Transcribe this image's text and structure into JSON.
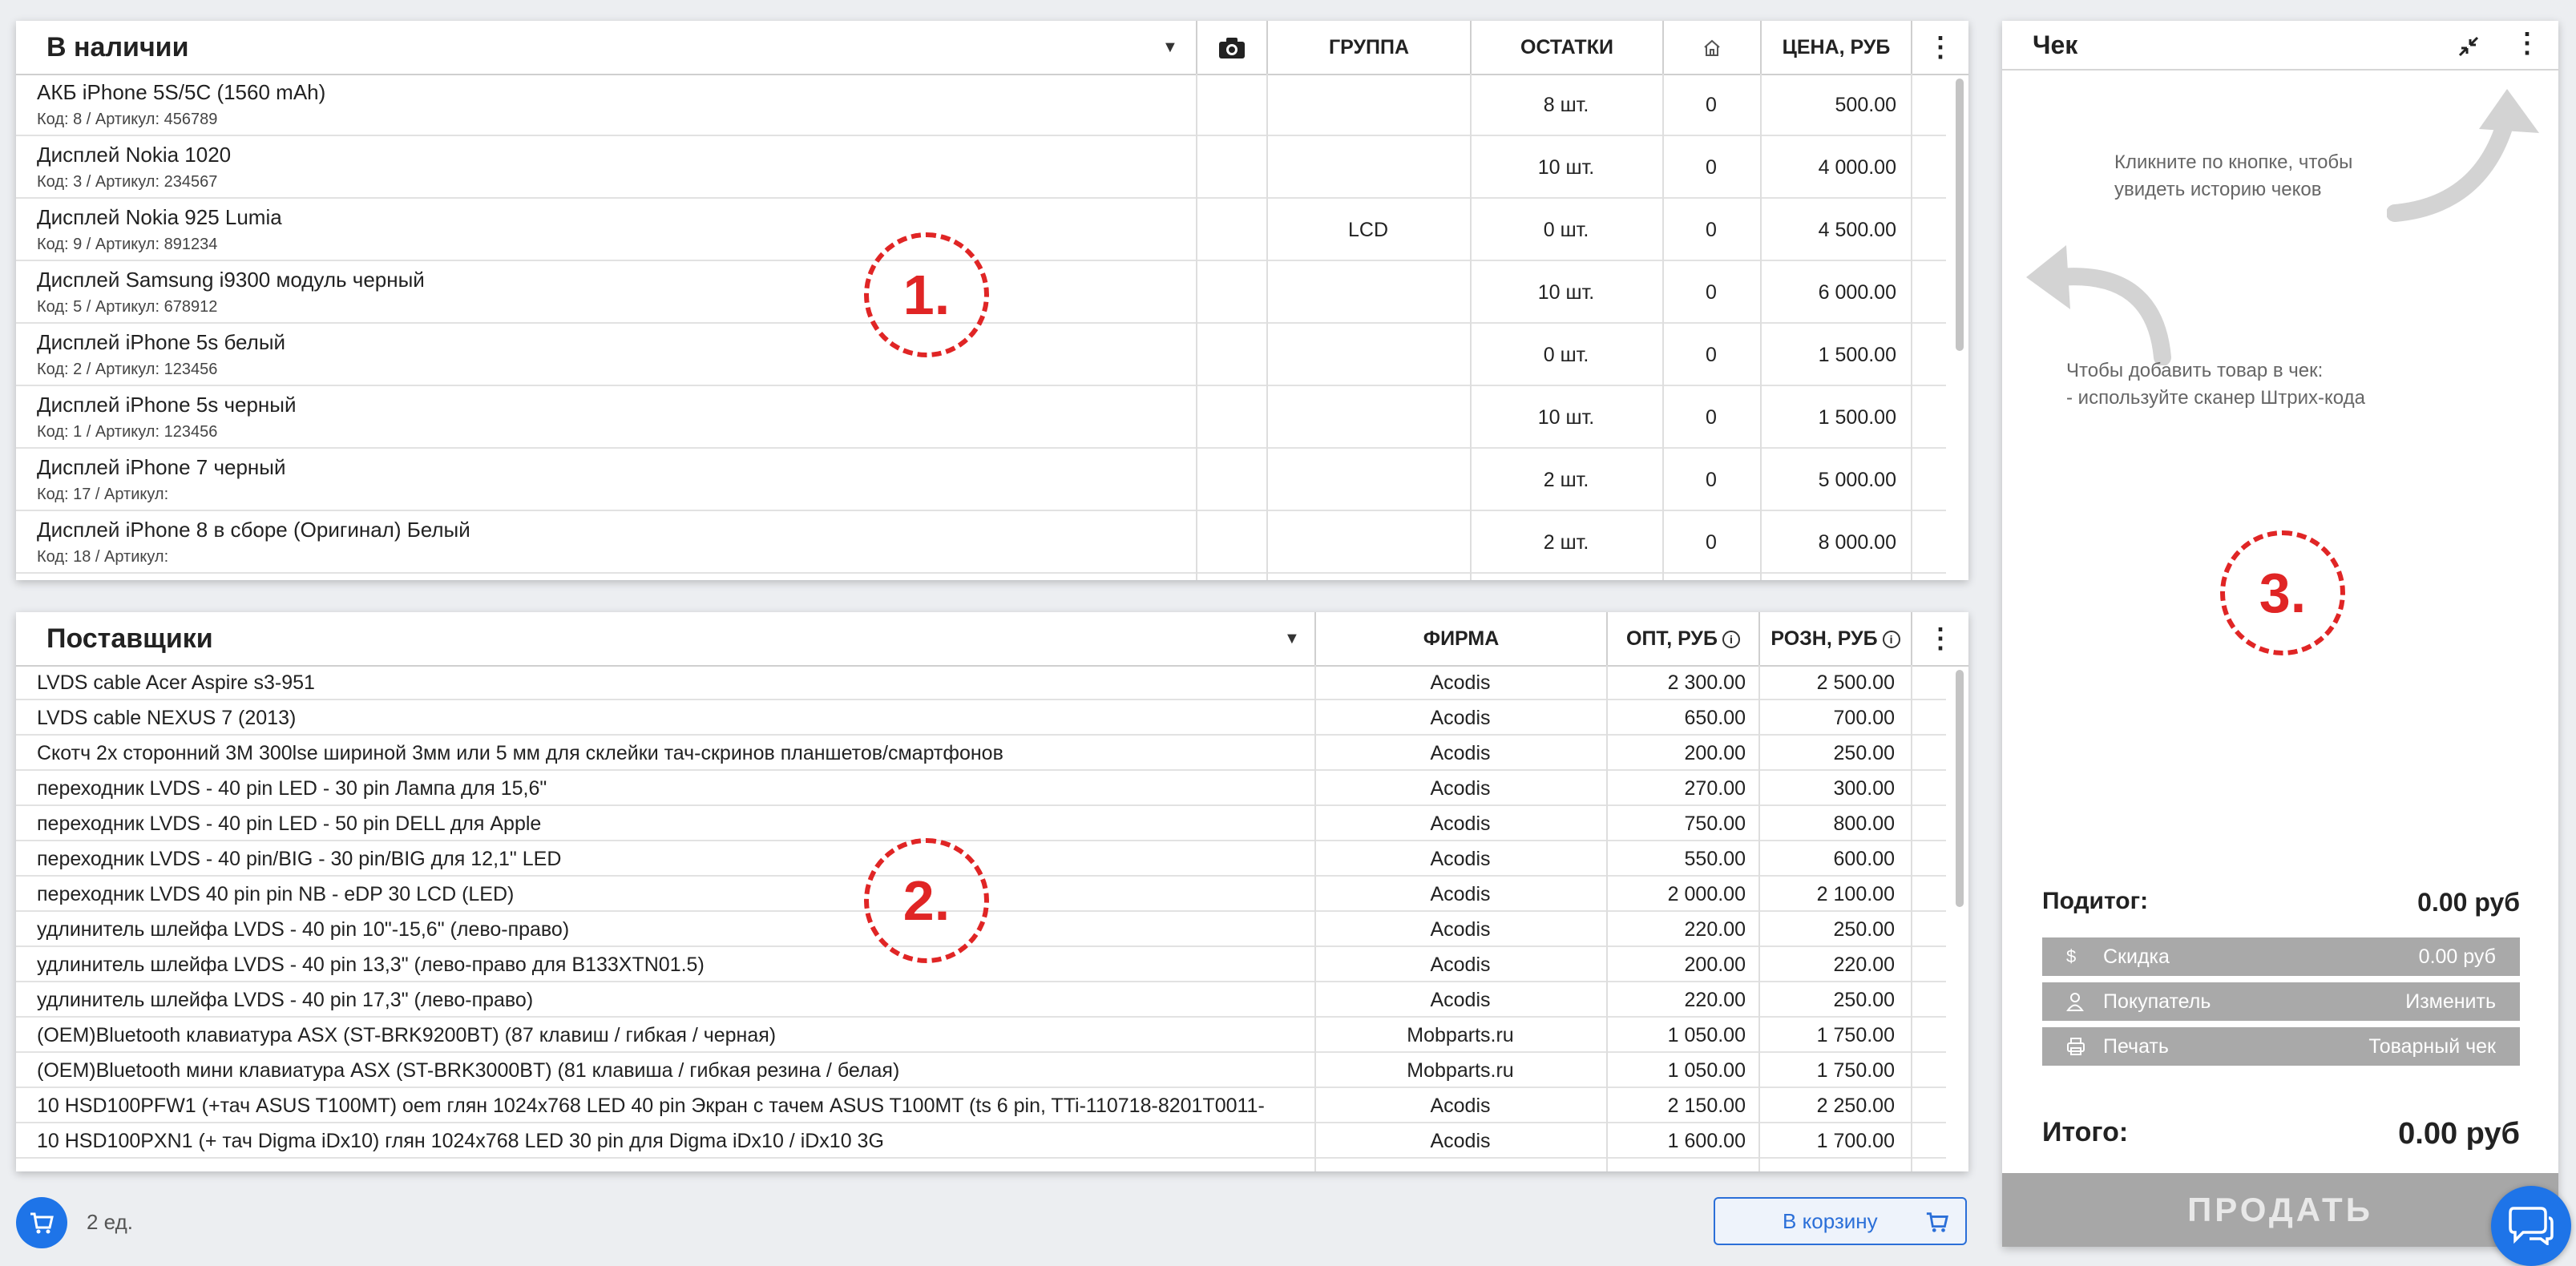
{
  "stock": {
    "title": "В наличии",
    "columns": {
      "group": "ГРУППА",
      "remains": "ОСТАТКИ",
      "price": "ЦЕНА, РУБ"
    },
    "rows": [
      {
        "name": "АКБ iPhone 5S/5C (1560 mAh)",
        "sub": "Код: 8 / Артикул: 456789",
        "group": "",
        "remains": "8 шт.",
        "home": "0",
        "price": "500.00"
      },
      {
        "name": "Дисплей Nokia 1020",
        "sub": "Код: 3 / Артикул: 234567",
        "group": "",
        "remains": "10 шт.",
        "home": "0",
        "price": "4 000.00"
      },
      {
        "name": "Дисплей Nokia 925 Lumia",
        "sub": "Код: 9 / Артикул: 891234",
        "group": "LCD",
        "remains": "0 шт.",
        "home": "0",
        "price": "4 500.00"
      },
      {
        "name": "Дисплей Samsung i9300 модуль черный",
        "sub": "Код: 5 / Артикул: 678912",
        "group": "",
        "remains": "10 шт.",
        "home": "0",
        "price": "6 000.00"
      },
      {
        "name": "Дисплей iPhone 5s белый",
        "sub": "Код: 2 / Артикул: 123456",
        "group": "",
        "remains": "0 шт.",
        "home": "0",
        "price": "1 500.00"
      },
      {
        "name": "Дисплей iPhone 5s черный",
        "sub": "Код: 1 / Артикул: 123456",
        "group": "",
        "remains": "10 шт.",
        "home": "0",
        "price": "1 500.00"
      },
      {
        "name": "Дисплей iPhone 7 черный",
        "sub": "Код: 17 / Артикул:",
        "group": "",
        "remains": "2 шт.",
        "home": "0",
        "price": "5 000.00"
      },
      {
        "name": "Дисплей iPhone 8 в сборе (Оригинал) Белый",
        "sub": "Код: 18 / Артикул:",
        "group": "",
        "remains": "2 шт.",
        "home": "0",
        "price": "8 000.00"
      }
    ]
  },
  "suppliers": {
    "title": "Поставщики",
    "columns": {
      "firm": "ФИРМА",
      "wholesale": "ОПТ, РУБ",
      "retail": "РОЗН, РУБ"
    },
    "rows": [
      {
        "name": "LVDS cable Acer Aspire s3-951",
        "firm": "Acodis",
        "wholesale": "2 300.00",
        "retail": "2 500.00"
      },
      {
        "name": "LVDS cable NEXUS 7 (2013)",
        "firm": "Acodis",
        "wholesale": "650.00",
        "retail": "700.00"
      },
      {
        "name": "Скотч 2х сторонний 3М 300lse шириной 3мм или 5 мм для склейки тач-скринов планшетов/смартфонов",
        "firm": "Acodis",
        "wholesale": "200.00",
        "retail": "250.00"
      },
      {
        "name": "переходник LVDS - 40 pin LED - 30 pin Лампа для 15,6\"",
        "firm": "Acodis",
        "wholesale": "270.00",
        "retail": "300.00"
      },
      {
        "name": "переходник LVDS - 40 pin LED - 50 pin DELL для Apple",
        "firm": "Acodis",
        "wholesale": "750.00",
        "retail": "800.00"
      },
      {
        "name": "переходник LVDS - 40 pin/BIG - 30 pin/BIG для 12,1\" LED",
        "firm": "Acodis",
        "wholesale": "550.00",
        "retail": "600.00"
      },
      {
        "name": "переходник LVDS 40 pin pin NB - eDP 30 LCD (LED)",
        "firm": "Acodis",
        "wholesale": "2 000.00",
        "retail": "2 100.00"
      },
      {
        "name": "удлинитель шлейфа LVDS - 40 pin 10\"-15,6\" (лево-право)",
        "firm": "Acodis",
        "wholesale": "220.00",
        "retail": "250.00"
      },
      {
        "name": "удлинитель шлейфа LVDS - 40 pin 13,3\" (лево-право для B133XTN01.5)",
        "firm": "Acodis",
        "wholesale": "200.00",
        "retail": "220.00"
      },
      {
        "name": "удлинитель шлейфа LVDS - 40 pin 17,3\" (лево-право)",
        "firm": "Acodis",
        "wholesale": "220.00",
        "retail": "250.00"
      },
      {
        "name": "(OEM)Bluetooth клавиатура ASX (ST-BRK9200BT) (87 клавиш / гибкая / черная)",
        "firm": "Mobparts.ru",
        "wholesale": "1 050.00",
        "retail": "1 750.00"
      },
      {
        "name": "(OEM)Bluetooth мини клавиатура ASX (ST-BRK3000BT) (81 клавиша / гибкая резина / белая)",
        "firm": "Mobparts.ru",
        "wholesale": "1 050.00",
        "retail": "1 750.00"
      },
      {
        "name": "10 HSD100PFW1 (+тач ASUS T100MT) oem глян 1024x768 LED 40 pin Экран с тачем ASUS T100MT (ts 6 pin, TTi-110718-8201T0011-",
        "firm": "Acodis",
        "wholesale": "2 150.00",
        "retail": "2 250.00"
      },
      {
        "name": "10 HSD100PXN1 (+ тач Digma iDx10) глян 1024x768 LED 30 pin для Digma iDx10 / iDx10 3G",
        "firm": "Acodis",
        "wholesale": "1 600.00",
        "retail": "1 700.00"
      }
    ]
  },
  "receipt": {
    "title": "Чек",
    "history_hint": "Кликните по кнопке, чтобы\nувидеть историю чеков",
    "add_hint": "Чтобы добавить товар в чек:\n- используйте сканер Штрих-кода",
    "subtotal_label": "Подитог:",
    "subtotal_value": "0.00 руб",
    "discount_label": "Скидка",
    "discount_value": "0.00 руб",
    "buyer_label": "Покупатель",
    "buyer_action": "Изменить",
    "print_label": "Печать",
    "print_value": "Товарный чек",
    "total_label": "Итого:",
    "total_value": "0.00 руб",
    "sell_label": "ПРОДАТЬ"
  },
  "markers": {
    "m1": "1.",
    "m2": "2.",
    "m3": "3."
  },
  "footer": {
    "count": "2 ед.",
    "to_cart": "В корзину"
  },
  "icons": {
    "stock_dropdown": "chevron-down-icon",
    "camera": "camera-icon",
    "warehouse": "home-icon",
    "kebab": "more-vertical-icon",
    "collapse": "collapse-icon",
    "cart": "cart-icon",
    "chat": "chat-icon",
    "info": "info-icon",
    "discount": "dollar-icon",
    "buyer": "user-icon",
    "print": "printer-icon"
  },
  "colors": {
    "accent": "#1e74e8",
    "marker": "#e02525",
    "disabled_button": "#a7a7a7"
  }
}
